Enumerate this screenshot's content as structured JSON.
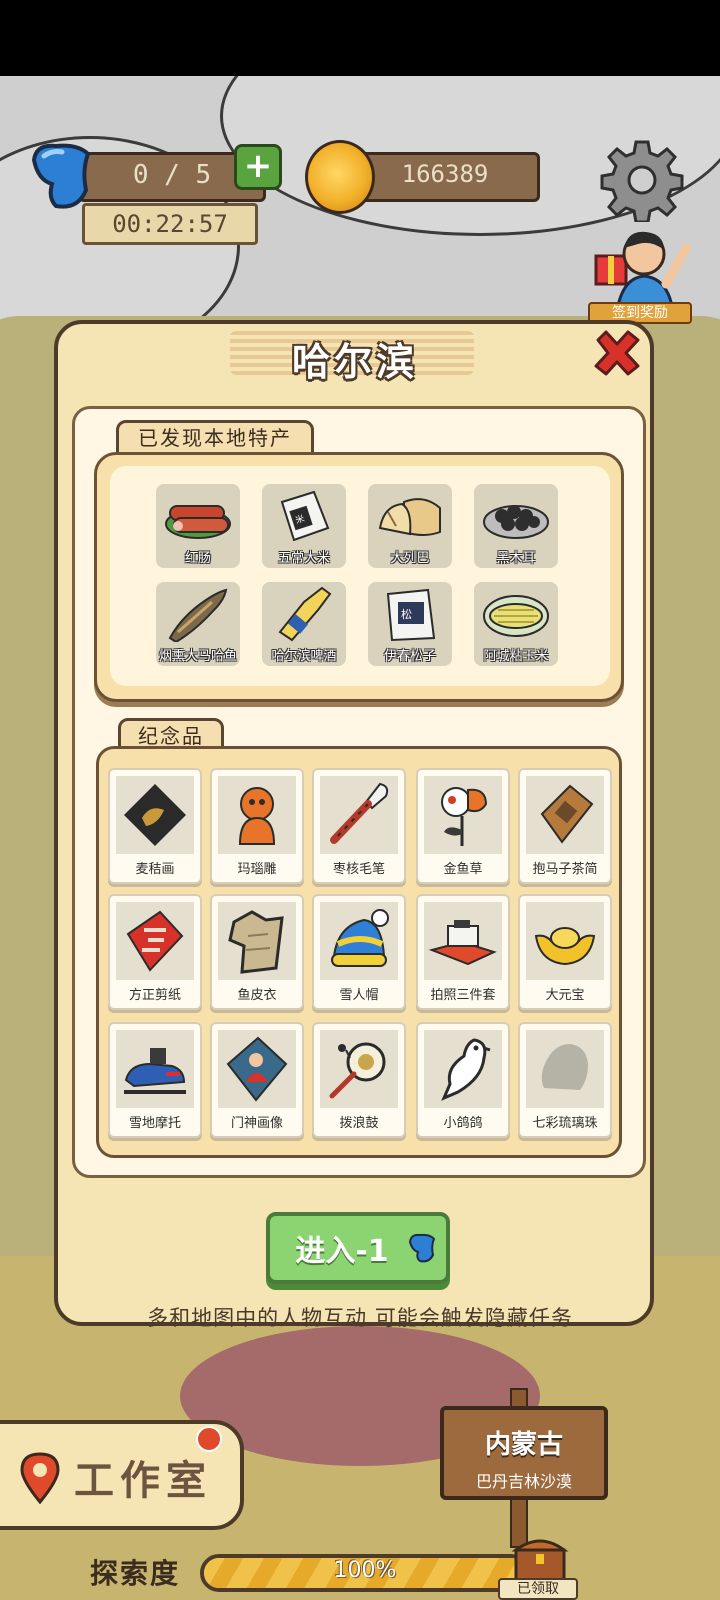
{
  "hud": {
    "energy": "0 / 5",
    "timer": "00:22:57",
    "coins": "166389",
    "sign_in_label": "签到奖励"
  },
  "dialog": {
    "title": "哈尔滨",
    "specialty_section": "已发现本地特产",
    "souvenir_section": "纪念品",
    "specialties": [
      {
        "label": "红肠",
        "icon": "sausage-icon"
      },
      {
        "label": "五常大米",
        "icon": "rice-bag-icon"
      },
      {
        "label": "大列巴",
        "icon": "bread-icon"
      },
      {
        "label": "黑木耳",
        "icon": "black-fungus-icon"
      },
      {
        "label": "烟熏大马哈鱼",
        "icon": "smoked-fish-icon"
      },
      {
        "label": "哈尔滨啤酒",
        "icon": "beer-bottle-icon"
      },
      {
        "label": "伊春松子",
        "icon": "pine-nut-bag-icon"
      },
      {
        "label": "阿城粘玉米",
        "icon": "corn-icon"
      }
    ],
    "souvenirs": [
      {
        "label": "麦秸画",
        "icon": "straw-painting-icon"
      },
      {
        "label": "玛瑙雕",
        "icon": "agate-carving-icon"
      },
      {
        "label": "枣核毛笔",
        "icon": "brush-pen-icon"
      },
      {
        "label": "金鱼草",
        "icon": "snapdragon-flower-icon"
      },
      {
        "label": "抱马子茶简",
        "icon": "tea-packet-icon"
      },
      {
        "label": "方正剪纸",
        "icon": "paper-cut-icon"
      },
      {
        "label": "鱼皮衣",
        "icon": "fish-skin-coat-icon"
      },
      {
        "label": "雪人帽",
        "icon": "snow-hat-icon"
      },
      {
        "label": "拍照三件套",
        "icon": "photo-props-icon"
      },
      {
        "label": "大元宝",
        "icon": "gold-ingot-icon"
      },
      {
        "label": "雪地摩托",
        "icon": "snowmobile-icon"
      },
      {
        "label": "门神画像",
        "icon": "door-god-icon"
      },
      {
        "label": "拨浪鼓",
        "icon": "rattle-drum-icon"
      },
      {
        "label": "小鸽鸽",
        "icon": "pigeon-icon"
      },
      {
        "label": "七彩琉璃珠",
        "icon": "glass-bead-silhouette-icon"
      }
    ],
    "enter_button": "进入-1",
    "hint": "多和地图中的人物互动 可能会触发隐藏任务"
  },
  "bottom": {
    "studio": "工作室",
    "region_name": "内蒙古",
    "region_sub": "巴丹吉林沙漠",
    "explore_label": "探索度",
    "explore_value": "100%",
    "explore_fraction": 1.0,
    "claimed_label": "已领取"
  },
  "colors": {
    "panel_bg": "#f6e5b4",
    "border_brown": "#4d3a28",
    "button_green": "#8cd371",
    "close_red": "#d8312a"
  }
}
